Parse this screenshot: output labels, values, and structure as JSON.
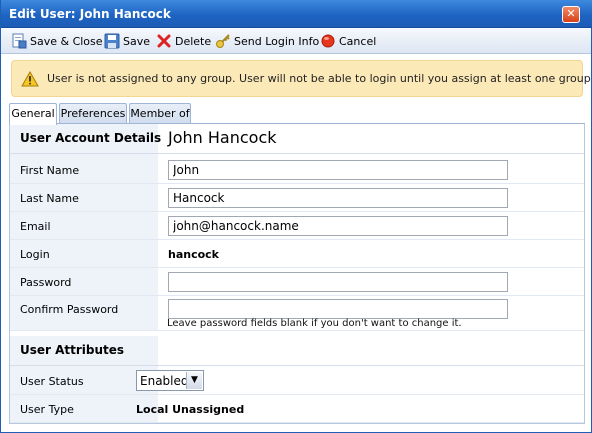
{
  "window": {
    "title": "Edit User: John Hancock",
    "close_symbol": "✕"
  },
  "toolbar": {
    "save_close": "Save & Close",
    "save": "Save",
    "delete": "Delete",
    "send_login": "Send Login Info",
    "cancel": "Cancel"
  },
  "warning": {
    "text": "User is not assigned to any group. User will not be able to login until you assign at least one group."
  },
  "tabs": {
    "general": "General",
    "preferences": "Preferences",
    "member_of": "Member of"
  },
  "account": {
    "section_title": "User Account Details",
    "display_name": "John Hancock",
    "first_name_label": "First Name",
    "first_name": "John",
    "last_name_label": "Last Name",
    "last_name": "Hancock",
    "email_label": "Email",
    "email": "john@hancock.name",
    "login_label": "Login",
    "login": "hancock",
    "password_label": "Password",
    "password": "",
    "confirm_label": "Confirm Password",
    "confirm": "",
    "password_hint": "Leave password fields blank if you don't want to change it."
  },
  "attributes": {
    "section_title": "User Attributes",
    "status_label": "User Status",
    "status_value": "Enabled",
    "type_label": "User Type",
    "type_value": "Local Unassigned"
  },
  "colors": {
    "titlebar": "#1f64c3",
    "warning_bg": "#fce9b8",
    "label_bg": "#eef3fa"
  }
}
